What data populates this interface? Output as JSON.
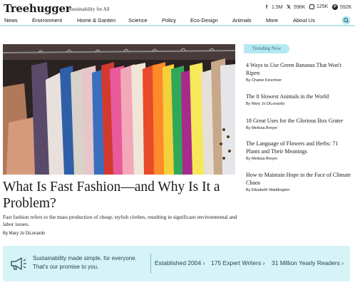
{
  "header": {
    "logo": "Treehugger",
    "tagline": "Sustainability for All",
    "social": [
      {
        "icon": "facebook-icon",
        "count": "1.5M"
      },
      {
        "icon": "x-icon",
        "count": "596K"
      },
      {
        "icon": "instagram-icon",
        "count": "125K"
      },
      {
        "icon": "pinterest-icon",
        "count": "592K"
      }
    ]
  },
  "nav": {
    "items": [
      "News",
      "Environment",
      "Home & Garden",
      "Science",
      "Policy",
      "Eco-Design",
      "Animals",
      "More",
      "About Us"
    ],
    "search_icon": "search-icon"
  },
  "hero": {
    "image": "clothing-rack-photo",
    "title": "What Is Fast Fashion—and Why Is It a Problem?",
    "description": "Fast fashion refers to the mass production of cheap, stylish clothes, resulting in significant environmental and labor issues.",
    "byline": "By Mary Jo DiLonardo"
  },
  "trending": {
    "label": "Trending Now",
    "items": [
      {
        "title": "4 Ways to Use Green Bananas That Won't Ripen",
        "byline": "By Chanie Kirschner"
      },
      {
        "title": "The 8 Slowest Animals in the World",
        "byline": "By Mary Jo DiLonardo"
      },
      {
        "title": "18 Great Uses for the Glorious Box Grater",
        "byline": "By Melissa Breyer"
      },
      {
        "title": "The Language of Flowers and Herbs: 71 Plants and Their Meanings",
        "byline": "By Melissa Breyer"
      },
      {
        "title": "How to Maintain Hope in the Face of Climate Chaos",
        "byline": "By Elizabeth Waddington"
      }
    ]
  },
  "banner": {
    "icon": "megaphone-icon",
    "message": "Sustainability made simple, for everyone. That's our promise to you.",
    "stats": [
      "Established 2004 ›",
      "175 Expert Writers ›",
      "31 Million Yearly Readers ›"
    ]
  },
  "colors": {
    "accent": "#b5e8f1",
    "banner_bg": "#d6f3f7",
    "banner_text": "#234852"
  }
}
